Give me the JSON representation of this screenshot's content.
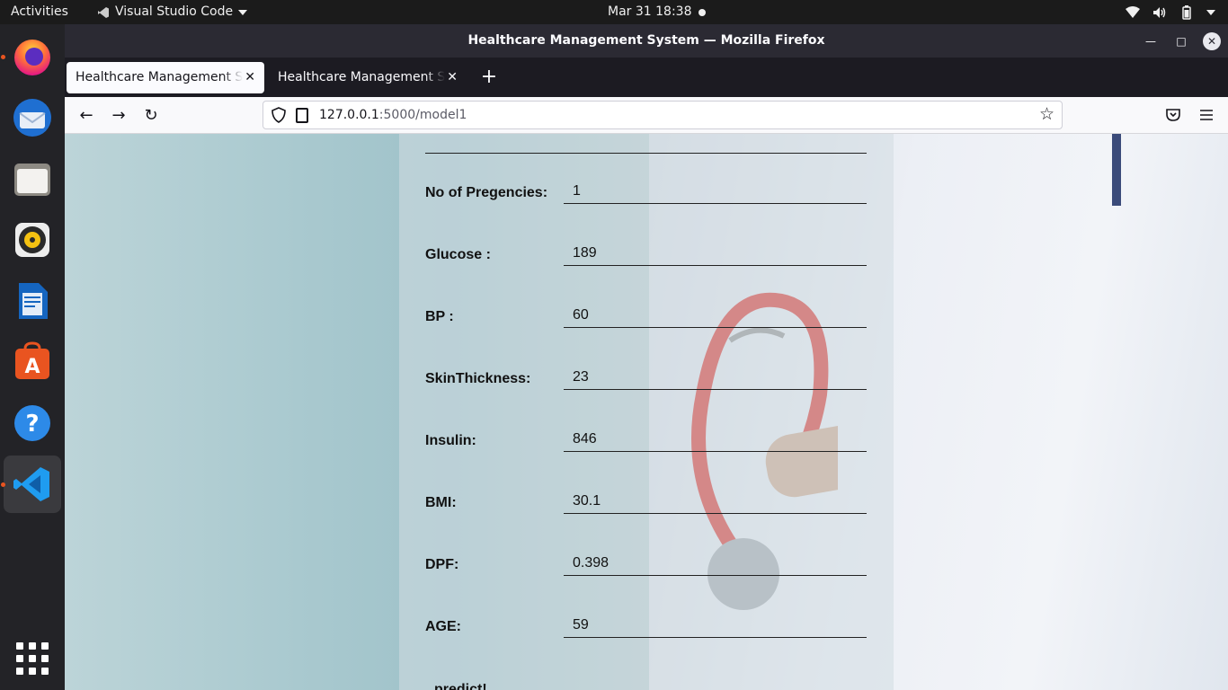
{
  "topbar": {
    "activities": "Activities",
    "app_name": "Visual Studio Code",
    "clock": "Mar 31  18:38",
    "tray_icons": [
      "wifi-icon",
      "volume-icon",
      "battery-icon",
      "power-menu-icon"
    ]
  },
  "dock": {
    "apps": [
      "Firefox",
      "Thunderbird",
      "Files",
      "Rhythmbox",
      "LibreOffice Writer",
      "Ubuntu Software",
      "Help",
      "Visual Studio Code"
    ],
    "icons": [
      "firefox-icon",
      "thunderbird-icon",
      "files-icon",
      "rhythmbox-icon",
      "writer-icon",
      "software-icon",
      "help-icon",
      "vscode-icon"
    ],
    "show_apps": "show-apps-icon"
  },
  "window": {
    "title": "Healthcare Management System — Mozilla Firefox"
  },
  "tabs": [
    {
      "label": "Healthcare Management System",
      "selected": true
    },
    {
      "label": "Healthcare Management System",
      "selected": false
    }
  ],
  "urlbar": {
    "host": "127.0.0.1",
    "path": ":5000/model1"
  },
  "form": {
    "fields": [
      {
        "label": "No of Pregencies:",
        "value": "1"
      },
      {
        "label": "Glucose :",
        "value": "189"
      },
      {
        "label": "BP :",
        "value": "60"
      },
      {
        "label": "SkinThickness:",
        "value": "23"
      },
      {
        "label": "Insulin:",
        "value": "846"
      },
      {
        "label": "BMI:",
        "value": "30.1"
      },
      {
        "label": "DPF:",
        "value": "0.398"
      },
      {
        "label": "AGE:",
        "value": "59"
      }
    ],
    "submit_label": "predict!"
  },
  "colors": {
    "accent": "#e95420",
    "firefox_chrome": "#2b2a33",
    "tabstrip": "#1c1b22"
  }
}
